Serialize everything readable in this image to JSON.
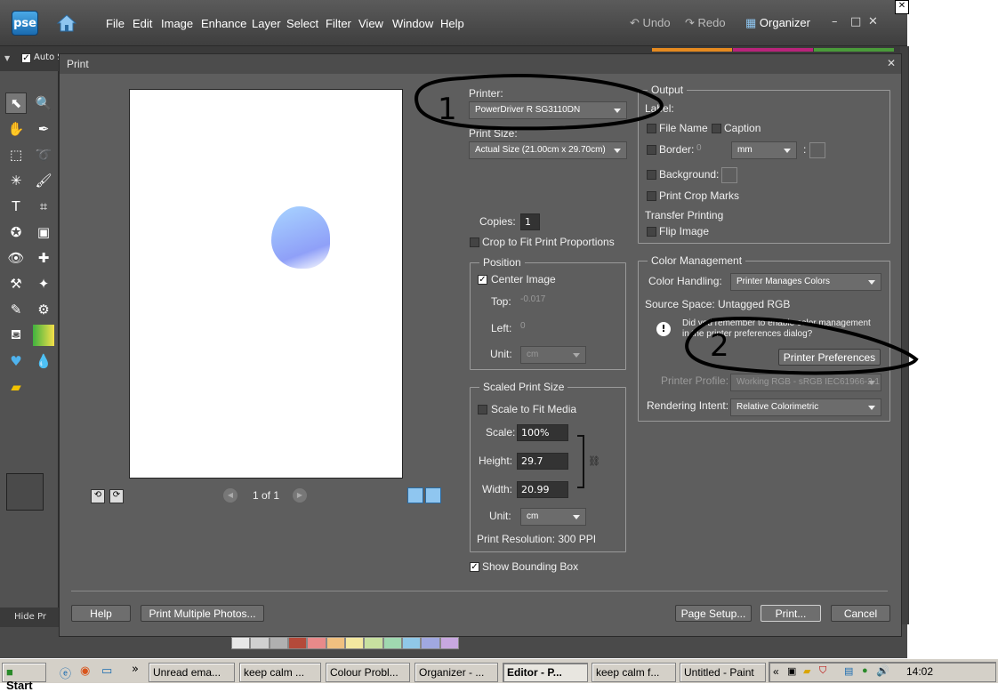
{
  "app": {
    "logo": "pse",
    "menu": [
      "File",
      "Edit",
      "Image",
      "Enhance",
      "Layer",
      "Select",
      "Filter",
      "View",
      "Window",
      "Help"
    ],
    "undo": "Undo",
    "redo": "Redo",
    "organizer": "Organizer",
    "options_auto": "Auto S",
    "hide_label": "Hide Pr"
  },
  "dialog": {
    "title": "Print",
    "printer_label": "Printer:",
    "printer_value": "PowerDriver R SG3110DN",
    "print_size_label": "Print Size:",
    "print_size_value": "Actual Size (21.00cm x 29.70cm)",
    "copies_label": "Copies:",
    "copies_value": "1",
    "crop_fit_label": "Crop to Fit Print Proportions",
    "page_indicator": "1 of 1",
    "position": {
      "title": "Position",
      "center_image": "Center Image",
      "top_label": "Top:",
      "top_value": "-0.017",
      "left_label": "Left:",
      "left_value": "0",
      "unit_label": "Unit:",
      "unit_value": "cm"
    },
    "scaled": {
      "title": "Scaled Print Size",
      "scale_fit": "Scale to Fit Media",
      "scale_label": "Scale:",
      "scale_value": "100%",
      "height_label": "Height:",
      "height_value": "29.7",
      "width_label": "Width:",
      "width_value": "20.99",
      "unit_label": "Unit:",
      "unit_value": "cm",
      "resolution": "Print Resolution: 300 PPI"
    },
    "show_bbox": "Show Bounding Box",
    "output": {
      "title": "Output",
      "label_label": "Label:",
      "file_name": "File Name",
      "caption": "Caption",
      "border": "Border:",
      "border_value": "0",
      "border_unit": "mm",
      "background": "Background:",
      "crop_marks": "Print Crop Marks",
      "transfer": "Transfer Printing",
      "flip": "Flip Image"
    },
    "color": {
      "title": "Color Management",
      "handling_label": "Color Handling:",
      "handling_value": "Printer Manages Colors",
      "source_label": "Source Space:",
      "source_value": "Untagged RGB",
      "notice": "Did you remember to enable color management in the printer preferences dialog?",
      "printer_prefs": "Printer Preferences",
      "profile_label": "Printer Profile:",
      "profile_value": "Working RGB - sRGB IEC61966-2.1",
      "intent_label": "Rendering Intent:",
      "intent_value": "Relative Colorimetric"
    },
    "buttons": {
      "help": "Help",
      "multiple": "Print Multiple Photos...",
      "page_setup": "Page Setup...",
      "print": "Print...",
      "cancel": "Cancel"
    }
  },
  "annotations": {
    "one": "1",
    "two": "2"
  },
  "taskbar": {
    "start": "Start",
    "tasks": [
      "Unread ema...",
      "keep calm ...",
      "Colour Probl...",
      "Organizer - ...",
      "Editor - P...",
      "keep calm f...",
      "Untitled - Paint"
    ],
    "active_index": 4,
    "clock": "14:02"
  },
  "colors": {
    "accent": "#4aa8e6",
    "dialog_bg": "#5e5e5e",
    "preview_blob": "#8fa0f8"
  }
}
